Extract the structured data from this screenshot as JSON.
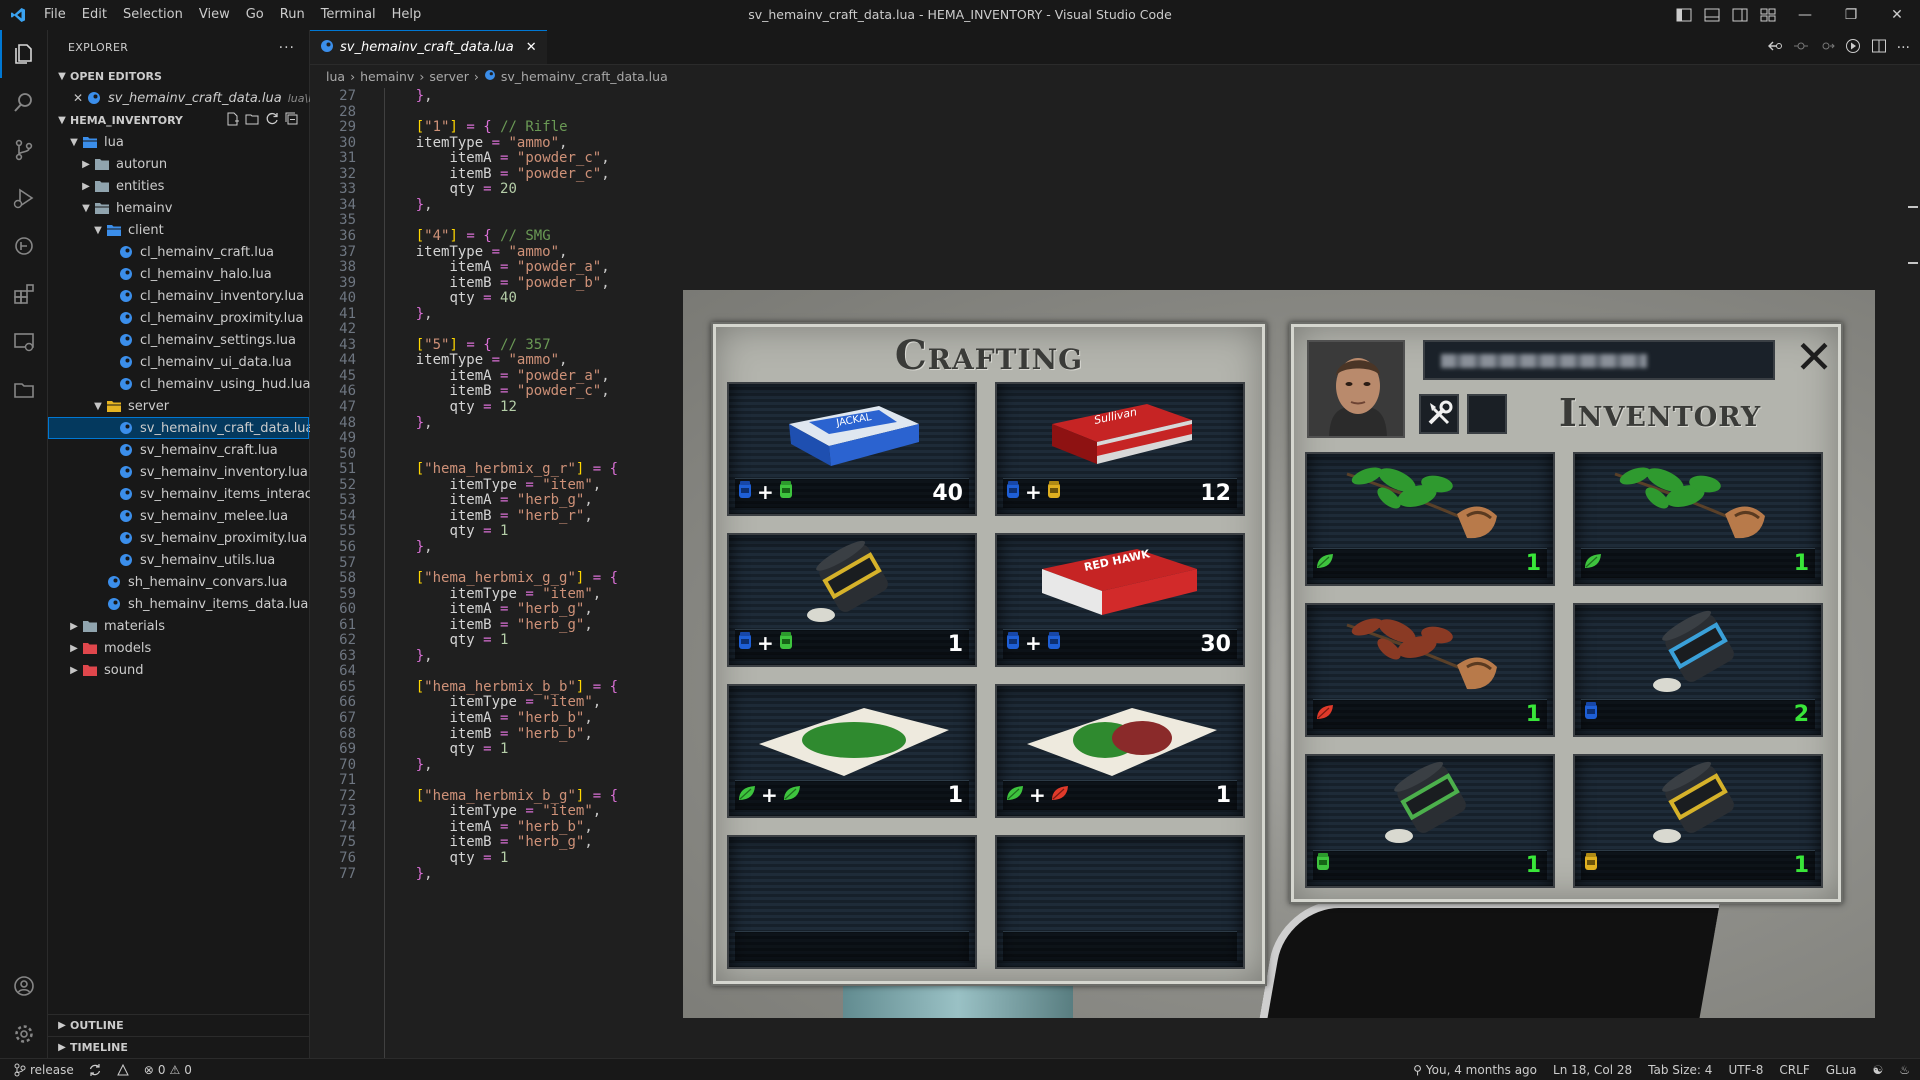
{
  "window": {
    "title": "sv_hemainv_craft_data.lua - HEMA_INVENTORY - Visual Studio Code",
    "menu": [
      "File",
      "Edit",
      "Selection",
      "View",
      "Go",
      "Run",
      "Terminal",
      "Help"
    ]
  },
  "colors": {
    "accent": "#0078d4",
    "string": "#ce9178",
    "keyword": "#ffd700",
    "comment": "#6a9955",
    "qty_green": "#39e639"
  },
  "sidebar": {
    "title": "EXPLORER",
    "open_editors_label": "OPEN EDITORS",
    "open_editor": {
      "name": "sv_hemainv_craft_data.lua",
      "desc": "lua\\he..."
    },
    "workspace_label": "HEMA_INVENTORY",
    "tree": [
      {
        "name": "lua",
        "depth": 1,
        "type": "folder-open",
        "icon": "folder-icon"
      },
      {
        "name": "autorun",
        "depth": 2,
        "type": "folder",
        "icon": "folder-icon"
      },
      {
        "name": "entities",
        "depth": 2,
        "type": "folder",
        "icon": "folder-icon"
      },
      {
        "name": "hemainv",
        "depth": 2,
        "type": "folder-open",
        "icon": "folder-icon"
      },
      {
        "name": "client",
        "depth": 3,
        "type": "folder-open",
        "icon": "folder-icon"
      },
      {
        "name": "cl_hemainv_craft.lua",
        "depth": 4,
        "type": "file",
        "icon": "lua-file-icon"
      },
      {
        "name": "cl_hemainv_halo.lua",
        "depth": 4,
        "type": "file",
        "icon": "lua-file-icon"
      },
      {
        "name": "cl_hemainv_inventory.lua",
        "depth": 4,
        "type": "file",
        "icon": "lua-file-icon"
      },
      {
        "name": "cl_hemainv_proximity.lua",
        "depth": 4,
        "type": "file",
        "icon": "lua-file-icon"
      },
      {
        "name": "cl_hemainv_settings.lua",
        "depth": 4,
        "type": "file",
        "icon": "lua-file-icon"
      },
      {
        "name": "cl_hemainv_ui_data.lua",
        "depth": 4,
        "type": "file",
        "icon": "lua-file-icon"
      },
      {
        "name": "cl_hemainv_using_hud.lua",
        "depth": 4,
        "type": "file",
        "icon": "lua-file-icon"
      },
      {
        "name": "server",
        "depth": 3,
        "type": "folder-open",
        "icon": "folder-icon"
      },
      {
        "name": "sv_hemainv_craft_data.lua",
        "depth": 4,
        "type": "file",
        "icon": "lua-file-icon",
        "selected": true
      },
      {
        "name": "sv_hemainv_craft.lua",
        "depth": 4,
        "type": "file",
        "icon": "lua-file-icon"
      },
      {
        "name": "sv_hemainv_inventory.lua",
        "depth": 4,
        "type": "file",
        "icon": "lua-file-icon"
      },
      {
        "name": "sv_hemainv_items_interact.lua",
        "depth": 4,
        "type": "file",
        "icon": "lua-file-icon"
      },
      {
        "name": "sv_hemainv_melee.lua",
        "depth": 4,
        "type": "file",
        "icon": "lua-file-icon"
      },
      {
        "name": "sv_hemainv_proximity.lua",
        "depth": 4,
        "type": "file",
        "icon": "lua-file-icon"
      },
      {
        "name": "sv_hemainv_utils.lua",
        "depth": 4,
        "type": "file",
        "icon": "lua-file-icon"
      },
      {
        "name": "sh_hemainv_convars.lua",
        "depth": 3,
        "type": "file",
        "icon": "lua-file-icon"
      },
      {
        "name": "sh_hemainv_items_data.lua",
        "depth": 3,
        "type": "file",
        "icon": "lua-file-icon"
      },
      {
        "name": "materials",
        "depth": 1,
        "type": "folder",
        "icon": "folder-icon"
      },
      {
        "name": "models",
        "depth": 1,
        "type": "folder-red",
        "icon": "folder-icon"
      },
      {
        "name": "sound",
        "depth": 1,
        "type": "folder-red",
        "icon": "folder-icon"
      }
    ],
    "outline_label": "OUTLINE",
    "timeline_label": "TIMELINE"
  },
  "editor": {
    "tab": "sv_hemainv_craft_data.lua",
    "breadcrumb": [
      "lua",
      "hemainv",
      "server",
      "sv_hemainv_craft_data.lua"
    ],
    "lines": [
      {
        "n": "27",
        "t": "    },",
        "fold": ""
      },
      {
        "n": "28",
        "t": "",
        "fold": ""
      },
      {
        "n": "29",
        "t": "    [\"1\"] = { // Rifle"
      },
      {
        "n": "30",
        "t": "    itemType = \"ammo\","
      },
      {
        "n": "31",
        "t": "        itemA = \"powder_c\","
      },
      {
        "n": "32",
        "t": "        itemB = \"powder_c\","
      },
      {
        "n": "33",
        "t": "        qty = 20"
      },
      {
        "n": "34",
        "t": "    },"
      },
      {
        "n": "35",
        "t": ""
      },
      {
        "n": "36",
        "t": "    [\"4\"] = { // SMG"
      },
      {
        "n": "37",
        "t": "    itemType = \"ammo\","
      },
      {
        "n": "38",
        "t": "        itemA = \"powder_a\","
      },
      {
        "n": "39",
        "t": "        itemB = \"powder_b\","
      },
      {
        "n": "40",
        "t": "        qty = 40"
      },
      {
        "n": "41",
        "t": "    },"
      },
      {
        "n": "42",
        "t": ""
      },
      {
        "n": "43",
        "t": "    [\"5\"] = { // 357"
      },
      {
        "n": "44",
        "t": "    itemType = \"ammo\","
      },
      {
        "n": "45",
        "t": "        itemA = \"powder_a\","
      },
      {
        "n": "46",
        "t": "        itemB = \"powder_c\","
      },
      {
        "n": "47",
        "t": "        qty = 12"
      },
      {
        "n": "48",
        "t": "    },"
      },
      {
        "n": "49",
        "t": ""
      },
      {
        "n": "50",
        "t": ""
      },
      {
        "n": "51",
        "t": "    [\"hema_herbmix_g_r\"] = {"
      },
      {
        "n": "52",
        "t": "        itemType = \"item\","
      },
      {
        "n": "53",
        "t": "        itemA = \"herb_g\","
      },
      {
        "n": "54",
        "t": "        itemB = \"herb_r\","
      },
      {
        "n": "55",
        "t": "        qty = 1"
      },
      {
        "n": "56",
        "t": "    },"
      },
      {
        "n": "57",
        "t": ""
      },
      {
        "n": "58",
        "t": "    [\"hema_herbmix_g_g\"] = {"
      },
      {
        "n": "59",
        "t": "        itemType = \"item\","
      },
      {
        "n": "60",
        "t": "        itemA = \"herb_g\","
      },
      {
        "n": "61",
        "t": "        itemB = \"herb_g\","
      },
      {
        "n": "62",
        "t": "        qty = 1"
      },
      {
        "n": "63",
        "t": "    },"
      },
      {
        "n": "64",
        "t": ""
      },
      {
        "n": "65",
        "t": "    [\"hema_herbmix_b_b\"] = {"
      },
      {
        "n": "66",
        "t": "        itemType = \"item\","
      },
      {
        "n": "67",
        "t": "        itemA = \"herb_b\","
      },
      {
        "n": "68",
        "t": "        itemB = \"herb_b\","
      },
      {
        "n": "69",
        "t": "        qty = 1"
      },
      {
        "n": "70",
        "t": "    },"
      },
      {
        "n": "71",
        "t": ""
      },
      {
        "n": "72",
        "t": "    [\"hema_herbmix_b_g\"] = {"
      },
      {
        "n": "73",
        "t": "        itemType = \"item\","
      },
      {
        "n": "74",
        "t": "        itemA = \"herb_b\","
      },
      {
        "n": "75",
        "t": "        itemB = \"herb_g\","
      },
      {
        "n": "76",
        "t": "        qty = 1"
      },
      {
        "n": "77",
        "t": "    },"
      }
    ]
  },
  "game": {
    "crafting_title": "Crafting",
    "inventory_title": "Inventory",
    "close_label": "✕",
    "crafting_slots": [
      {
        "art": "ammo-box-blue",
        "recipe": [
          "powder-blue",
          "powder-green"
        ],
        "qty": "40"
      },
      {
        "art": "ammo-box-red",
        "recipe": [
          "powder-blue",
          "powder-yellow"
        ],
        "qty": "12"
      },
      {
        "art": "powder-jar-yellow",
        "recipe": [
          "powder-blue",
          "powder-green"
        ],
        "qty": "1"
      },
      {
        "art": "ammo-box-redhawk",
        "recipe": [
          "powder-blue",
          "powder-blue"
        ],
        "qty": "30"
      },
      {
        "art": "herbmix-green",
        "recipe": [
          "herb-green",
          "herb-green"
        ],
        "qty": "1"
      },
      {
        "art": "herbmix-red",
        "recipe": [
          "herb-green",
          "herb-red"
        ],
        "qty": "1"
      },
      {
        "art": "",
        "recipe": [],
        "qty": ""
      },
      {
        "art": "",
        "recipe": [],
        "qty": ""
      }
    ],
    "inventory_slots": [
      {
        "art": "herb-plant-green",
        "icon": "herb-green",
        "qty": "1"
      },
      {
        "art": "herb-plant-green",
        "icon": "herb-green",
        "qty": "1"
      },
      {
        "art": "herb-plant-red",
        "icon": "herb-red",
        "qty": "1"
      },
      {
        "art": "powder-jar-blue",
        "icon": "powder-blue",
        "qty": "2"
      },
      {
        "art": "powder-jar-green",
        "icon": "powder-green",
        "qty": "1"
      },
      {
        "art": "powder-jar-yellow",
        "icon": "powder-yellow",
        "qty": "1"
      }
    ]
  },
  "statusbar": {
    "branch": "release",
    "errors": "0",
    "warnings": "0",
    "blame": "You, 4 months ago",
    "position": "Ln 18, Col 28",
    "tab_size": "Tab Size: 4",
    "encoding": "UTF-8",
    "eol": "CRLF",
    "language": "GLua"
  }
}
